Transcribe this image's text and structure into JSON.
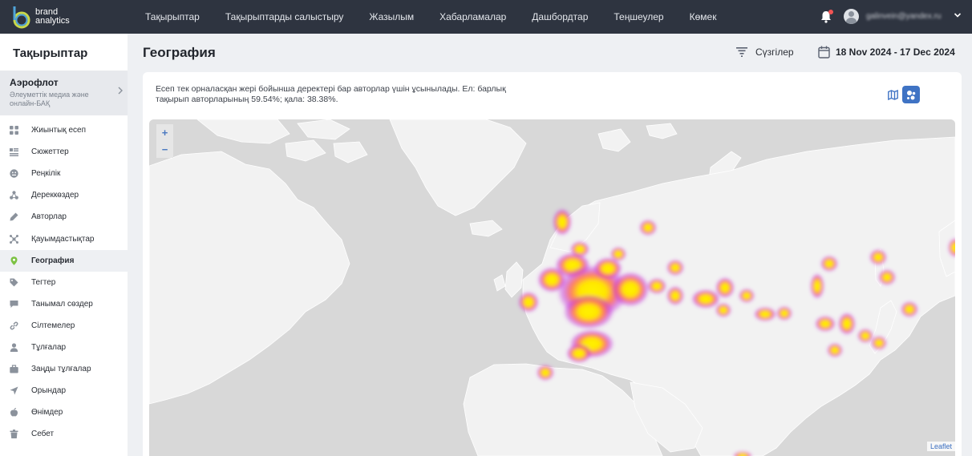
{
  "brand": {
    "line1": "brand",
    "line2": "analytics"
  },
  "nav": {
    "items": [
      "Тақырыптар",
      "Тақырыптарды салыстыру",
      "Жазылым",
      "Хабарламалар",
      "Дашбордтар",
      "Теңшеулер",
      "Көмек"
    ]
  },
  "user": {
    "email": "galinvein@yandex.ru"
  },
  "sidebar": {
    "title": "Тақырыптар",
    "project": {
      "name": "Аэрофлот",
      "description": "Әлеуметтік медиа және онлайн-БАҚ"
    },
    "items": [
      {
        "label": "Жиынтық есеп",
        "icon": "grid-icon"
      },
      {
        "label": "Сюжеттер",
        "icon": "stories-icon"
      },
      {
        "label": "Реңкілік",
        "icon": "tone-icon"
      },
      {
        "label": "Дереккөздер",
        "icon": "sources-icon"
      },
      {
        "label": "Авторлар",
        "icon": "pen-icon"
      },
      {
        "label": "Қауымдастықтар",
        "icon": "communities-icon"
      },
      {
        "label": "География",
        "icon": "location-pin-icon",
        "active": true
      },
      {
        "label": "Тегтер",
        "icon": "tag-icon"
      },
      {
        "label": "Танымал сөздер",
        "icon": "chat-bubble-icon"
      },
      {
        "label": "Сілтемелер",
        "icon": "link-icon"
      },
      {
        "label": "Тұлғалар",
        "icon": "person-icon"
      },
      {
        "label": "Заңды тұлғалар",
        "icon": "briefcase-icon"
      },
      {
        "label": "Орындар",
        "icon": "navigation-arrow-icon"
      },
      {
        "label": "Өнімдер",
        "icon": "apple-icon"
      },
      {
        "label": "Себет",
        "icon": "trash-icon"
      }
    ]
  },
  "main": {
    "title": "География",
    "filters_label": "Сүзгілер",
    "date_range": "18 Nov 2024 - 17 Dec 2024",
    "description": "Есеп тек орналасқан жері бойынша деректері бар авторлар үшін ұсынылады. Ел: барлық тақырып авторларының 59.54%; қала: 38.38%.",
    "map": {
      "zoom_in": "+",
      "zoom_out": "−",
      "attribution": "Leaflet",
      "mode": "heatmap"
    }
  },
  "colors": {
    "topbar": "#2e3440",
    "accent": "#3f73c4",
    "active_pin": "#7cc242",
    "heat_core": "#ffee00",
    "heat_edge": "#c83cdc"
  }
}
